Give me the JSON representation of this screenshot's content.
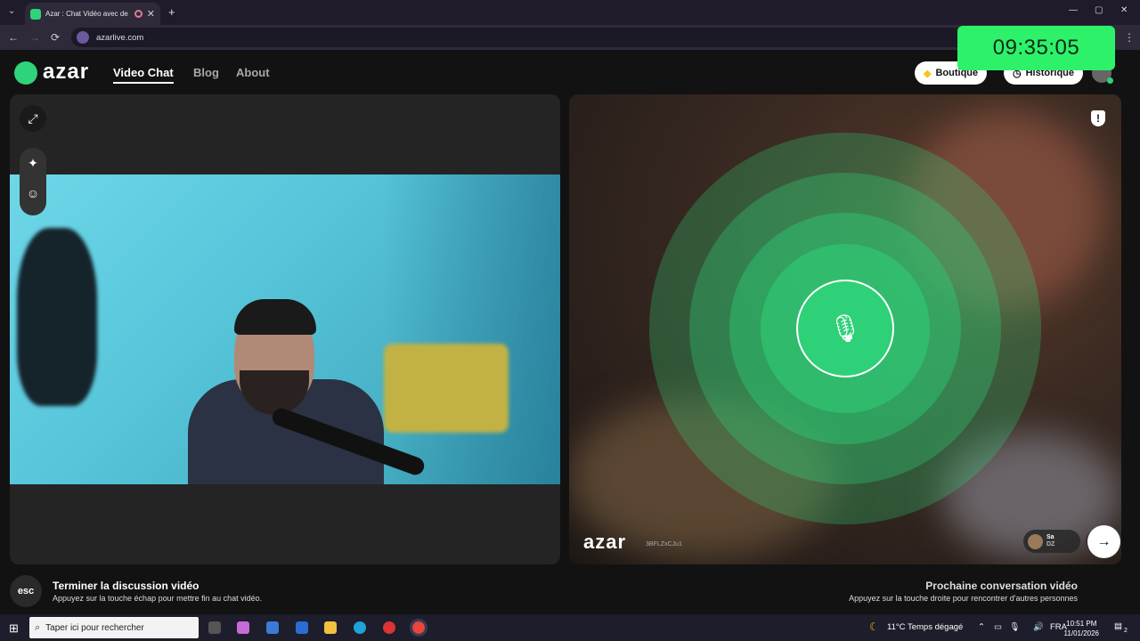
{
  "browser": {
    "tab_title": "Azar : Chat Vidéo avec de n",
    "url": "azarlive.com",
    "new_tab_label": "+",
    "back": "←",
    "forward": "→",
    "reload": "⟳",
    "minimize": "—",
    "maximize": "▢",
    "close": "✕"
  },
  "overlay_clock": "09:35:05",
  "site": {
    "logo": "azar",
    "nav": [
      "Video Chat",
      "Blog",
      "About"
    ],
    "boutique_label": "Boutique",
    "historique_label": "Historique"
  },
  "remote": {
    "watermark": "azar",
    "watermark_id": "3BFLZxCJu1",
    "peer_name": "Sa",
    "peer_country": "DZ"
  },
  "bottom": {
    "esc_label": "esc",
    "end_title": "Terminer la discussion vidéo",
    "end_sub": "Appuyez sur la touche échap pour mettre fin au chat vidéo.",
    "next_title": "Prochaine conversation vidéo",
    "next_sub": "Appuyez sur la touche droite pour rencontrer d'autres personnes",
    "next_arrow": "→"
  },
  "taskbar": {
    "search_placeholder": "Taper ici pour rechercher",
    "weather": "11°C  Temps dégagé",
    "lang": "FRA",
    "time": "10:51 PM",
    "date": "11/01/2026",
    "notif_count": "2"
  },
  "colors": {
    "accent": "#2ed37a",
    "clock_bg": "#2ef16a"
  }
}
